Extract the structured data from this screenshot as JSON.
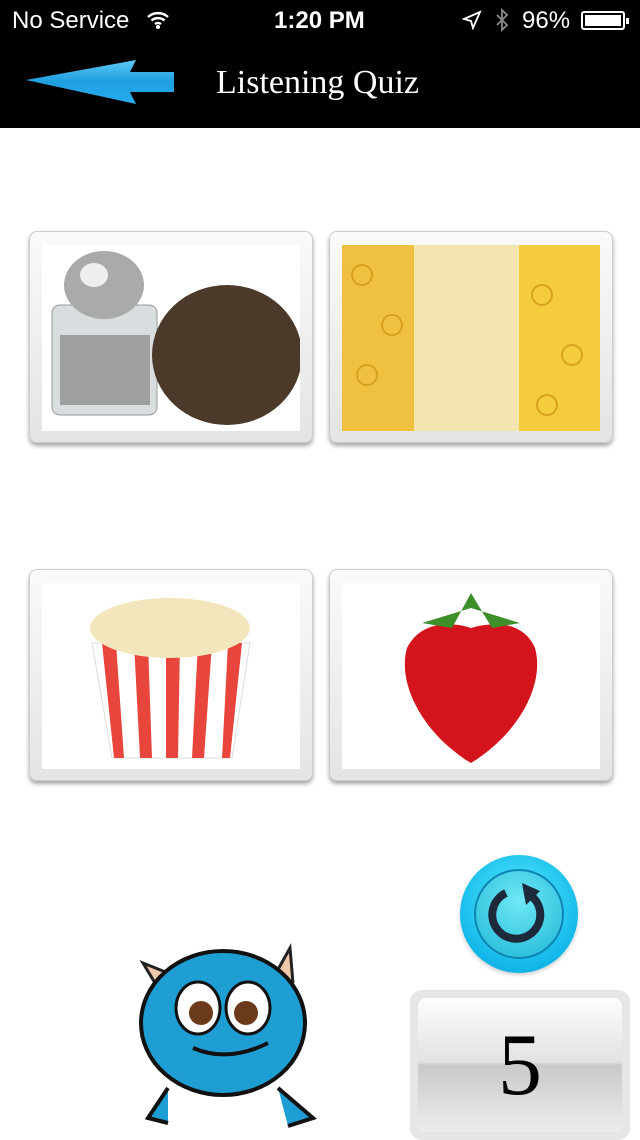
{
  "status_bar": {
    "carrier": "No Service",
    "time": "1:20 PM",
    "battery": "96%",
    "icons": [
      "wifi-icon",
      "location-icon",
      "bluetooth-icon",
      "battery-icon"
    ]
  },
  "nav": {
    "title": "Listening Quiz",
    "back_icon": "blue-arrow-left-icon"
  },
  "choices": [
    {
      "name": "pepper"
    },
    {
      "name": "pasta"
    },
    {
      "name": "popcorn"
    },
    {
      "name": "strawberry"
    }
  ],
  "replay": {
    "icon": "replay-icon"
  },
  "score": {
    "value": "5"
  },
  "colors": {
    "accent": "#1eb6ea"
  }
}
